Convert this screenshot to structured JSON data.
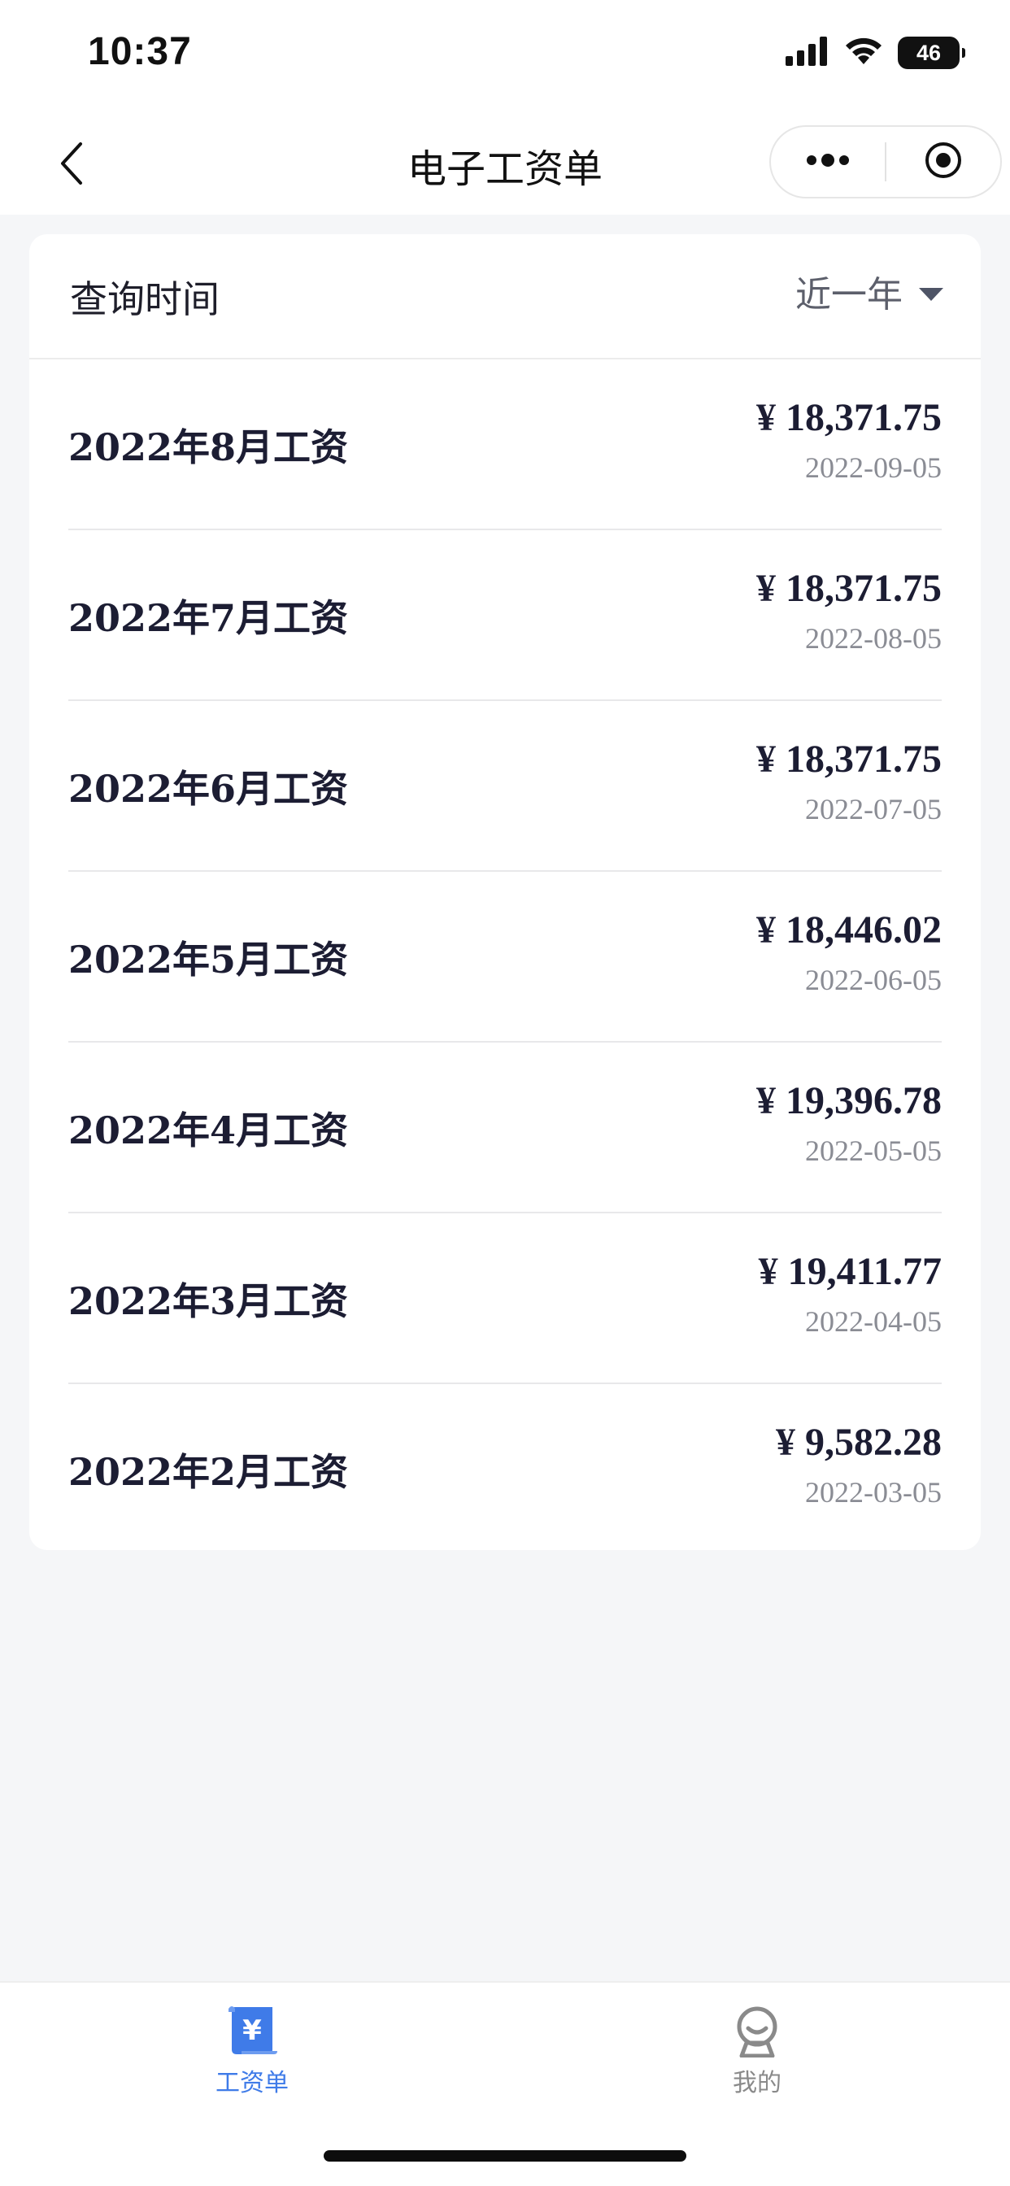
{
  "status_bar": {
    "time": "10:37",
    "battery_level": "46",
    "icons": [
      "cellular-signal-icon",
      "wifi-icon",
      "battery-icon"
    ]
  },
  "nav": {
    "title": "电子工资单",
    "back_icon": "chevron-left-icon",
    "menu_icon": "more-dots-icon",
    "close_icon": "target-circle-icon"
  },
  "filter": {
    "label": "查询时间",
    "value": "近一年"
  },
  "payslips": [
    {
      "title": "2022年8月工资",
      "amount": "¥ 18,371.75",
      "date": "2022-09-05"
    },
    {
      "title": "2022年7月工资",
      "amount": "¥ 18,371.75",
      "date": "2022-08-05"
    },
    {
      "title": "2022年6月工资",
      "amount": "¥ 18,371.75",
      "date": "2022-07-05"
    },
    {
      "title": "2022年5月工资",
      "amount": "¥ 18,446.02",
      "date": "2022-06-05"
    },
    {
      "title": "2022年4月工资",
      "amount": "¥ 19,396.78",
      "date": "2022-05-05"
    },
    {
      "title": "2022年3月工资",
      "amount": "¥ 19,411.77",
      "date": "2022-04-05"
    },
    {
      "title": "2022年2月工资",
      "amount": "¥ 9,582.28",
      "date": "2022-03-05"
    }
  ],
  "tabs": [
    {
      "label": "工资单",
      "icon": "payslip-icon",
      "active": true
    },
    {
      "label": "我的",
      "icon": "profile-icon",
      "active": false
    }
  ],
  "colors": {
    "accent": "#3f7be8",
    "background": "#f5f6f8",
    "text_primary": "#1c1d33",
    "text_secondary": "#8a8c94"
  }
}
